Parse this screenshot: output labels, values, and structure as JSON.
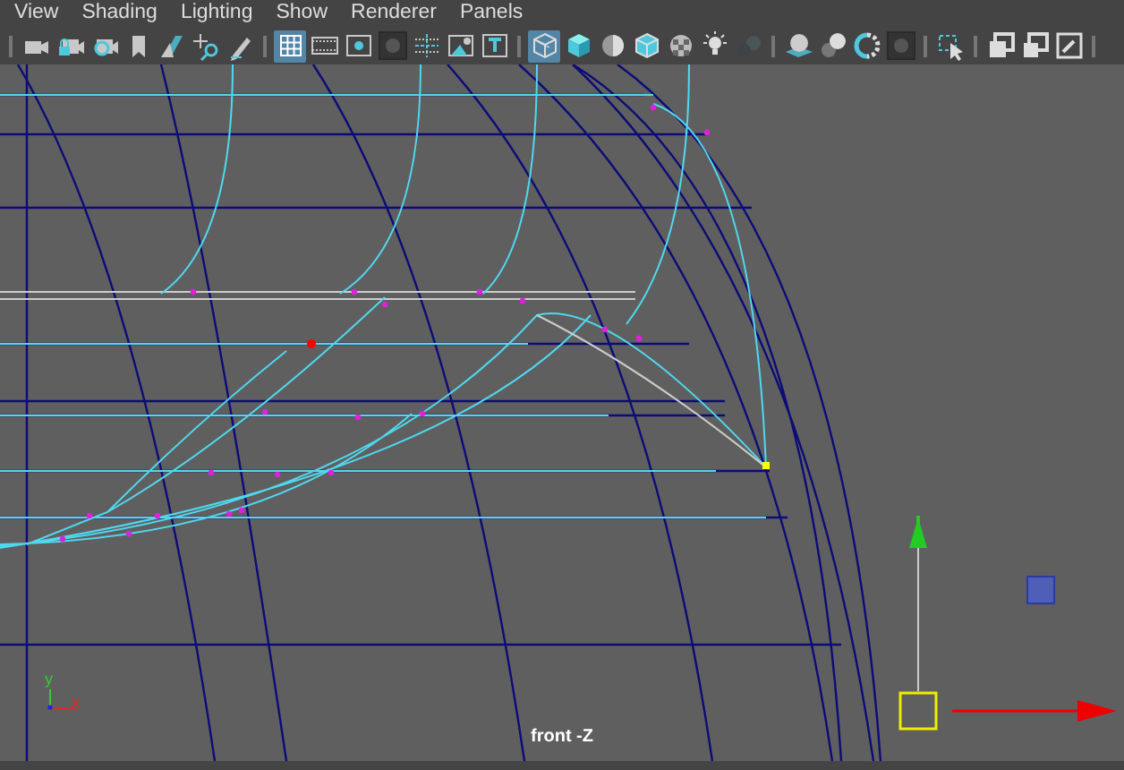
{
  "menu": [
    {
      "label": "View"
    },
    {
      "label": "Shading"
    },
    {
      "label": "Lighting"
    },
    {
      "label": "Show"
    },
    {
      "label": "Renderer"
    },
    {
      "label": "Panels"
    }
  ],
  "toolbar": [
    [
      {
        "kind": "camera",
        "selected": false
      },
      {
        "kind": "lock-camera",
        "selected": false
      },
      {
        "kind": "camera-attributes",
        "selected": false
      },
      {
        "kind": "bookmark",
        "selected": false
      },
      {
        "kind": "image-plane",
        "selected": false
      },
      {
        "kind": "pan-zoom",
        "selected": false
      },
      {
        "kind": "pencil",
        "selected": false
      }
    ],
    [
      {
        "kind": "grid",
        "selected": true
      },
      {
        "kind": "film-gate",
        "selected": false
      },
      {
        "kind": "resolution-gate",
        "selected": false
      },
      {
        "kind": "gate-mask",
        "selected": false
      },
      {
        "kind": "field-chart",
        "selected": false
      },
      {
        "kind": "safe-action",
        "selected": false
      },
      {
        "kind": "safe-title",
        "selected": false
      }
    ],
    [
      {
        "kind": "wire-cube",
        "selected": true
      },
      {
        "kind": "solid-cube",
        "selected": false
      },
      {
        "kind": "half-sphere",
        "selected": false
      },
      {
        "kind": "wire-on-shaded",
        "selected": false
      },
      {
        "kind": "checker",
        "selected": false
      },
      {
        "kind": "bulb",
        "selected": false
      },
      {
        "kind": "shadow",
        "selected": false
      }
    ],
    [
      {
        "kind": "occlusion",
        "selected": false
      },
      {
        "kind": "spheres",
        "selected": false
      },
      {
        "kind": "ring",
        "selected": false
      },
      {
        "kind": "gate-mask",
        "selected": false
      }
    ],
    [
      {
        "kind": "select-arrow",
        "selected": false
      }
    ],
    [
      {
        "kind": "overlap",
        "selected": false
      },
      {
        "kind": "corner",
        "selected": false
      },
      {
        "kind": "slash-box",
        "selected": false
      }
    ]
  ],
  "viewport": {
    "camera_label": "front -Z",
    "axis": {
      "y_label": "y",
      "x_label": "x"
    }
  }
}
